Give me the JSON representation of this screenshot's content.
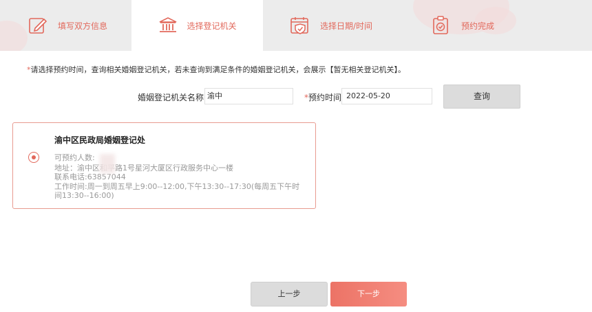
{
  "steps": [
    {
      "label": "填写双方信息",
      "icon": "edit-form-icon"
    },
    {
      "label": "选择登记机关",
      "icon": "government-building-icon"
    },
    {
      "label": "选择日期/时间",
      "icon": "calendar-shield-icon"
    },
    {
      "label": "预约完成",
      "icon": "clipboard-check-icon"
    }
  ],
  "colors": {
    "accent": "#e2685b",
    "button_gray": "#dcdcdc",
    "header_bg": "#ececec"
  },
  "hint": {
    "asterisk": "*",
    "text": "请选择预约时间，查询相关婚姻登记机关，若未查询到满足条件的婚姻登记机关，会展示【暂无相关登记机关】。"
  },
  "search": {
    "org_label": "婚姻登记机关名称",
    "org_value": "渝中",
    "time_asterisk": "*",
    "time_label": "预约时间",
    "time_value": "2022-05-20",
    "query_button": "查询"
  },
  "result": {
    "title": "渝中区民政局婚姻登记处",
    "available_label": "可预约人数:",
    "address": "地址：渝中区和平路1号星河大厦区行政服务中心一楼",
    "phone": "联系电话:63857044",
    "hours_line1": "工作时间:周一到周五早上9:00--12:00,下午13:30--17:30(每周五下午时",
    "hours_line2": "间13:30--16:00)"
  },
  "nav": {
    "prev": "上一步",
    "next": "下一步"
  }
}
